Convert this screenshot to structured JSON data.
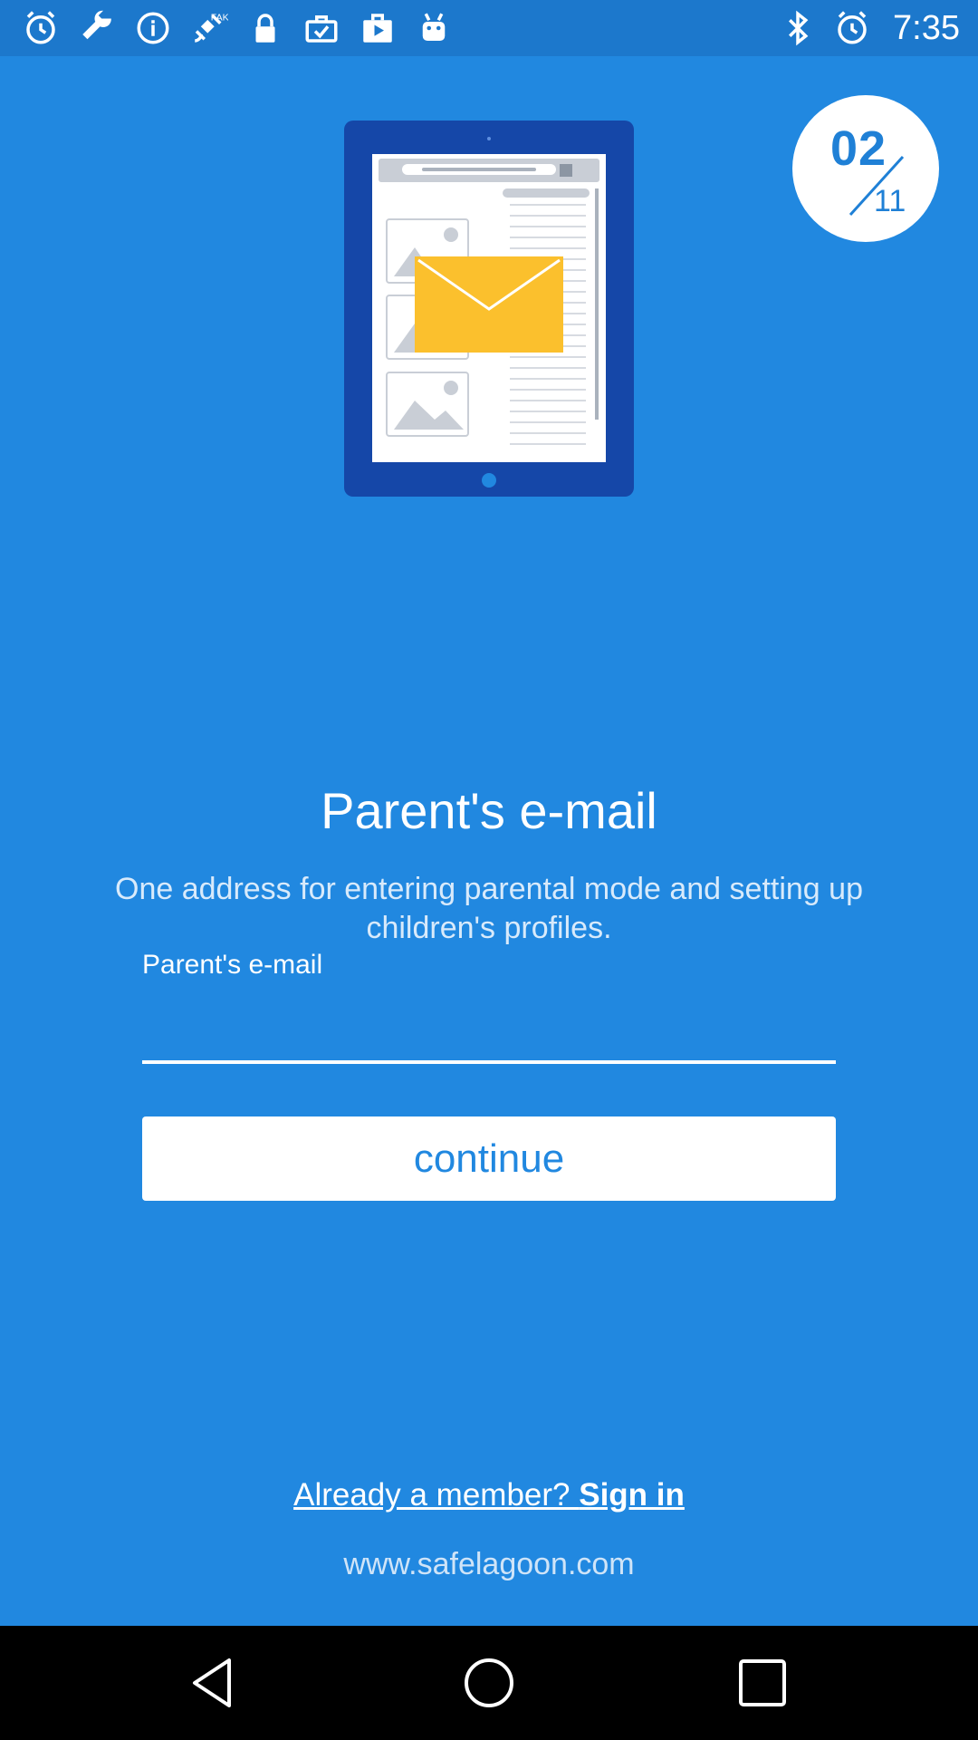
{
  "status_bar": {
    "time": "7:35",
    "left_icons": [
      "alarm-icon",
      "wrench-icon",
      "info-icon",
      "fake-gps-icon",
      "lock-icon",
      "briefcase-check-icon",
      "play-bag-icon",
      "android-icon"
    ],
    "right_icons": [
      "bluetooth-icon",
      "alarm-icon"
    ]
  },
  "progress": {
    "current": "02",
    "total": "11"
  },
  "title": "Parent's e-mail",
  "subtitle": "One address for entering parental mode and setting up children's profiles.",
  "email_field": {
    "label": "Parent's e-mail",
    "value": "",
    "placeholder": ""
  },
  "continue_button": {
    "label": "continue"
  },
  "signin": {
    "prefix": "Already a member? ",
    "action": "Sign in"
  },
  "website": "www.safelagoon.com",
  "navigation": {
    "buttons": [
      "back-icon",
      "home-icon",
      "recents-icon"
    ]
  },
  "colors": {
    "background": "#2188e0",
    "status_bar": "#1c78cc",
    "envelope": "#fbc02d",
    "tablet": "#1547a8"
  }
}
